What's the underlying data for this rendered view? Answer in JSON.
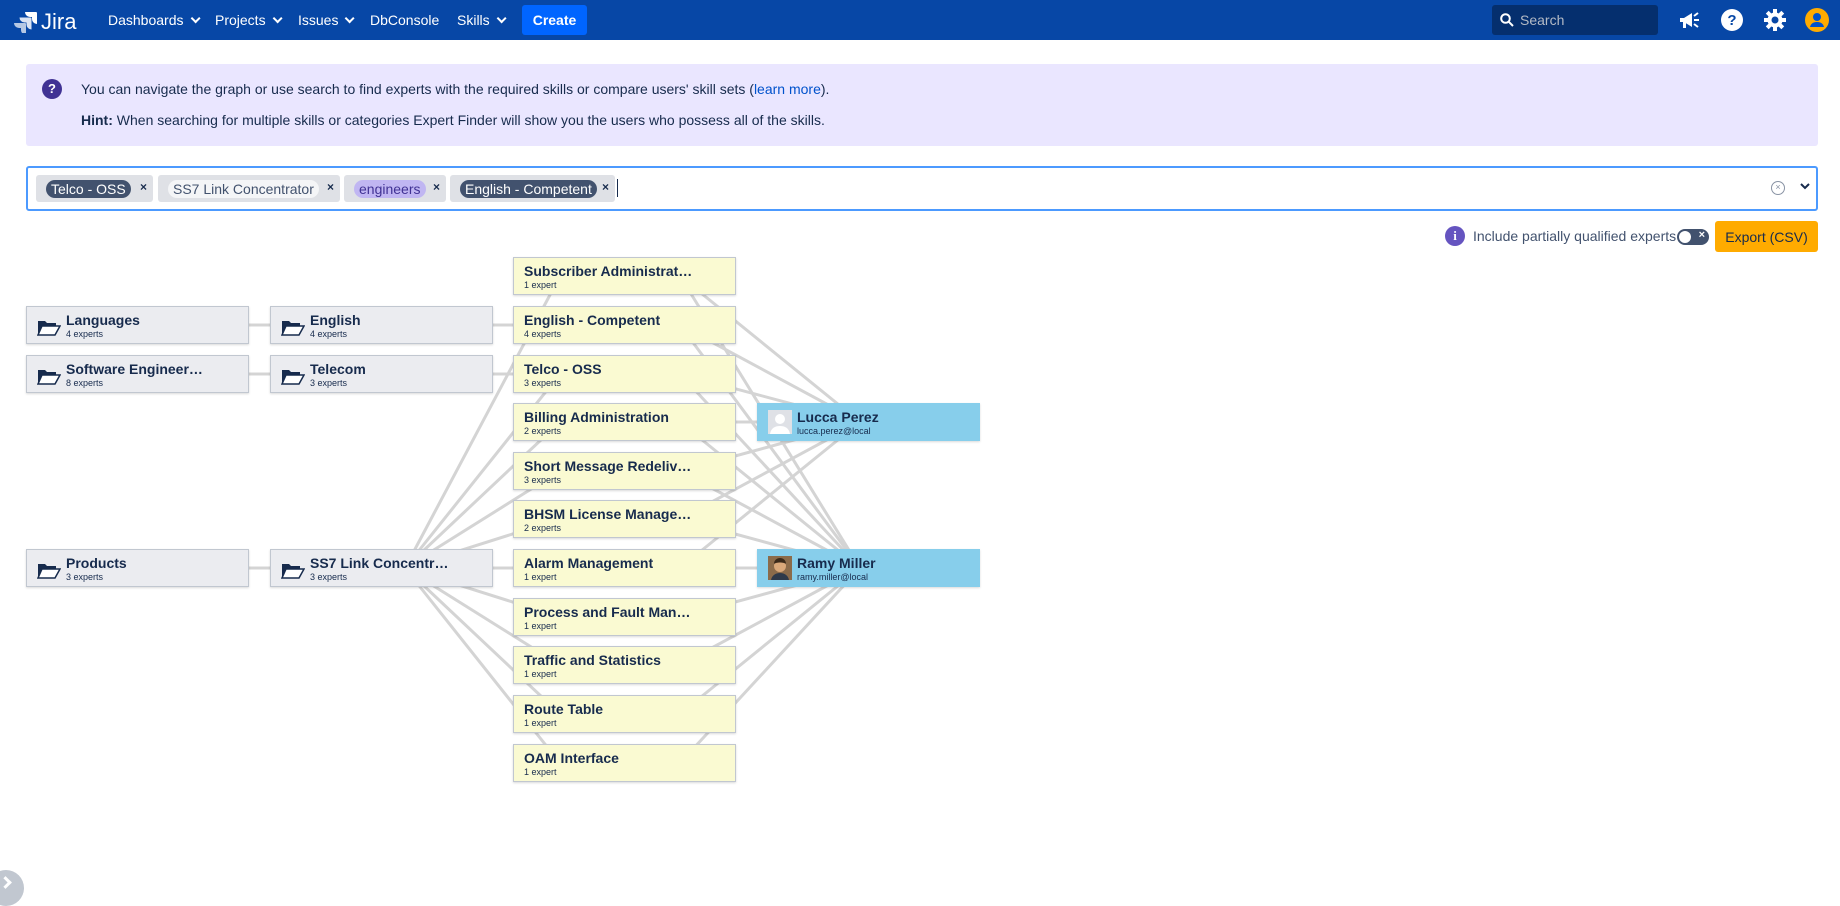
{
  "nav": {
    "app_name": "Jira",
    "items": [
      {
        "label": "Dashboards",
        "dropdown": true
      },
      {
        "label": "Projects",
        "dropdown": true
      },
      {
        "label": "Issues",
        "dropdown": true
      },
      {
        "label": "DbConsole",
        "dropdown": false
      },
      {
        "label": "Skills",
        "dropdown": true
      }
    ],
    "create_label": "Create",
    "search_placeholder": "Search",
    "icons": [
      "megaphone-icon",
      "help-icon",
      "settings-icon",
      "user-avatar"
    ]
  },
  "info": {
    "line1_text": "You can navigate the graph or use search to find experts with the required skills or compare users' skill sets (",
    "line1_link": "learn more",
    "line1_end": ").",
    "hint_label": "Hint:",
    "hint_text": " When searching for multiple skills or categories Expert Finder will show you the users who possess all of the skills."
  },
  "chips": [
    {
      "label": "Telco - OSS",
      "style": "dark"
    },
    {
      "label": "SS7 Link Concentrator",
      "style": "light"
    },
    {
      "label": "engineers",
      "style": "purple"
    },
    {
      "label": "English - Competent",
      "style": "dark"
    }
  ],
  "controls": {
    "partial_label": "Include partially qualified experts",
    "partial_enabled": false,
    "export_label": "Export (CSV)"
  },
  "graph": {
    "categories_l1": [
      {
        "id": "languages",
        "title": "Languages",
        "sub": "4 experts"
      },
      {
        "id": "softeng",
        "title": "Software Engineer…",
        "sub": "8 experts"
      },
      {
        "id": "products",
        "title": "Products",
        "sub": "3 experts"
      }
    ],
    "categories_l2": [
      {
        "id": "english",
        "title": "English",
        "sub": "4 experts"
      },
      {
        "id": "telecom",
        "title": "Telecom",
        "sub": "3 experts"
      },
      {
        "id": "ss7",
        "title": "SS7 Link Concentr…",
        "sub": "3 experts"
      }
    ],
    "skills": [
      {
        "id": "subadmin",
        "title": "Subscriber Administrat…",
        "sub": "1 expert"
      },
      {
        "id": "englishcomp",
        "title": "English - Competent",
        "sub": "4 experts"
      },
      {
        "id": "telcooss",
        "title": "Telco - OSS",
        "sub": "3 experts"
      },
      {
        "id": "billing",
        "title": "Billing Administration",
        "sub": "2 experts"
      },
      {
        "id": "sms",
        "title": "Short Message Redeliv…",
        "sub": "3 experts"
      },
      {
        "id": "bhsm",
        "title": "BHSM License Manage…",
        "sub": "2 experts"
      },
      {
        "id": "alarm",
        "title": "Alarm Management",
        "sub": "1 expert"
      },
      {
        "id": "pfm",
        "title": "Process and Fault Man…",
        "sub": "1 expert"
      },
      {
        "id": "traffic",
        "title": "Traffic and Statistics",
        "sub": "1 expert"
      },
      {
        "id": "route",
        "title": "Route Table",
        "sub": "1 expert"
      },
      {
        "id": "oam",
        "title": "OAM Interface",
        "sub": "1 expert"
      }
    ],
    "users": [
      {
        "id": "lucca",
        "name": "Lucca Perez",
        "email": "lucca.perez@local"
      },
      {
        "id": "ramy",
        "name": "Ramy Miller",
        "email": "ramy.miller@local"
      }
    ]
  }
}
